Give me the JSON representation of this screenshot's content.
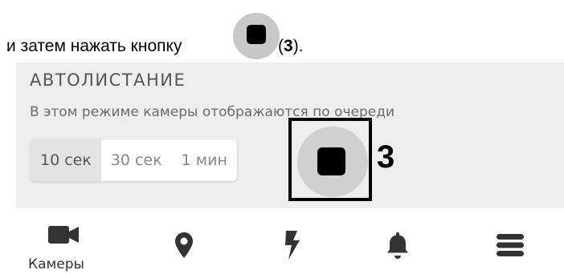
{
  "instruction": {
    "before": "и затем нажать кнопку",
    "after_open": "(",
    "ref_number": "3",
    "after_close": ")."
  },
  "autoscroll": {
    "title": "АВТОЛИСТАНИЕ",
    "description": "В этом режиме камеры отображаются по очереди",
    "intervals": [
      "10 сек",
      "30 сек",
      "1 мин"
    ],
    "selected_interval": "10 сек",
    "stop_icon": "stop-icon"
  },
  "callout": {
    "number": "3"
  },
  "nav": {
    "items": [
      {
        "icon": "video-camera-icon",
        "label": "Камеры"
      },
      {
        "icon": "map-pin-icon"
      },
      {
        "icon": "lightning-icon"
      },
      {
        "icon": "bell-icon"
      },
      {
        "icon": "menu-icon"
      }
    ]
  },
  "colors": {
    "panel_bg": "#eeeeee",
    "button_bg": "#d0d0d0",
    "icon": "#333333"
  }
}
